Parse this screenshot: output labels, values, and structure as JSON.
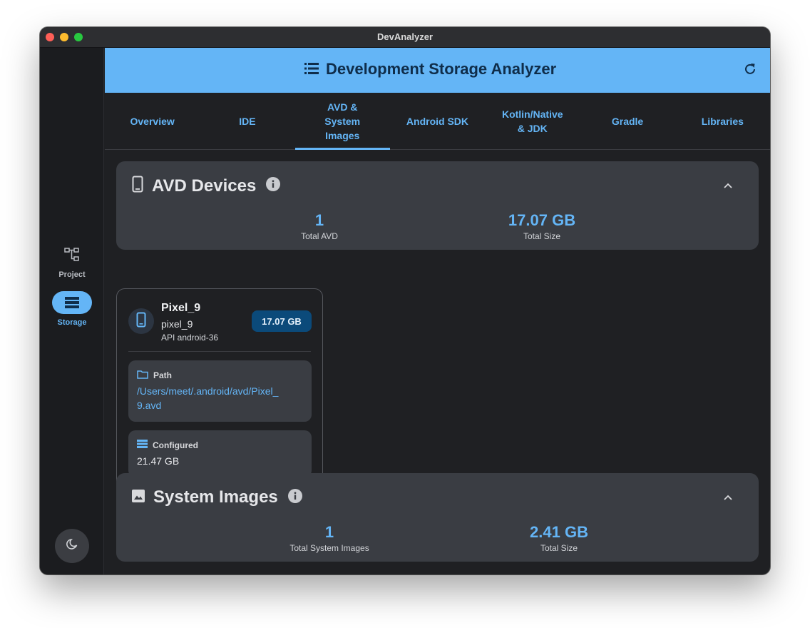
{
  "window": {
    "title": "DevAnalyzer"
  },
  "sidebar": {
    "items": [
      {
        "label": "Project",
        "icon": "project-tree-icon",
        "active": false
      },
      {
        "label": "Storage",
        "icon": "storage-icon",
        "active": true
      }
    ],
    "theme_icon": "moon-icon"
  },
  "header": {
    "title": "Development Storage Analyzer",
    "icon": "storage-list-icon"
  },
  "tabs": [
    {
      "label": "Overview"
    },
    {
      "label": "IDE"
    },
    {
      "label": "AVD &\nSystem\nImages",
      "active": true
    },
    {
      "label": "Android SDK"
    },
    {
      "label": "Kotlin/Native\n& JDK"
    },
    {
      "label": "Gradle"
    },
    {
      "label": "Libraries"
    }
  ],
  "avd_section": {
    "title": "AVD Devices",
    "stats": [
      {
        "value": "1",
        "label": "Total AVD"
      },
      {
        "value": "17.07 GB",
        "label": "Total Size"
      }
    ]
  },
  "device": {
    "name": "Pixel_9",
    "id": "pixel_9",
    "api": "API android-36",
    "size": "17.07 GB",
    "path_label": "Path",
    "path": "/Users/meet/.android/avd/Pixel_9.avd",
    "configured_label": "Configured",
    "configured_value": "21.47 GB"
  },
  "system_images_section": {
    "title": "System Images",
    "stats": [
      {
        "value": "1",
        "label": "Total System Images"
      },
      {
        "value": "2.41 GB",
        "label": "Total Size"
      }
    ]
  },
  "colors": {
    "accent": "#64b5f6",
    "header_bg": "#64b5f6",
    "surface": "#3a3d43",
    "background": "#1f2023"
  }
}
